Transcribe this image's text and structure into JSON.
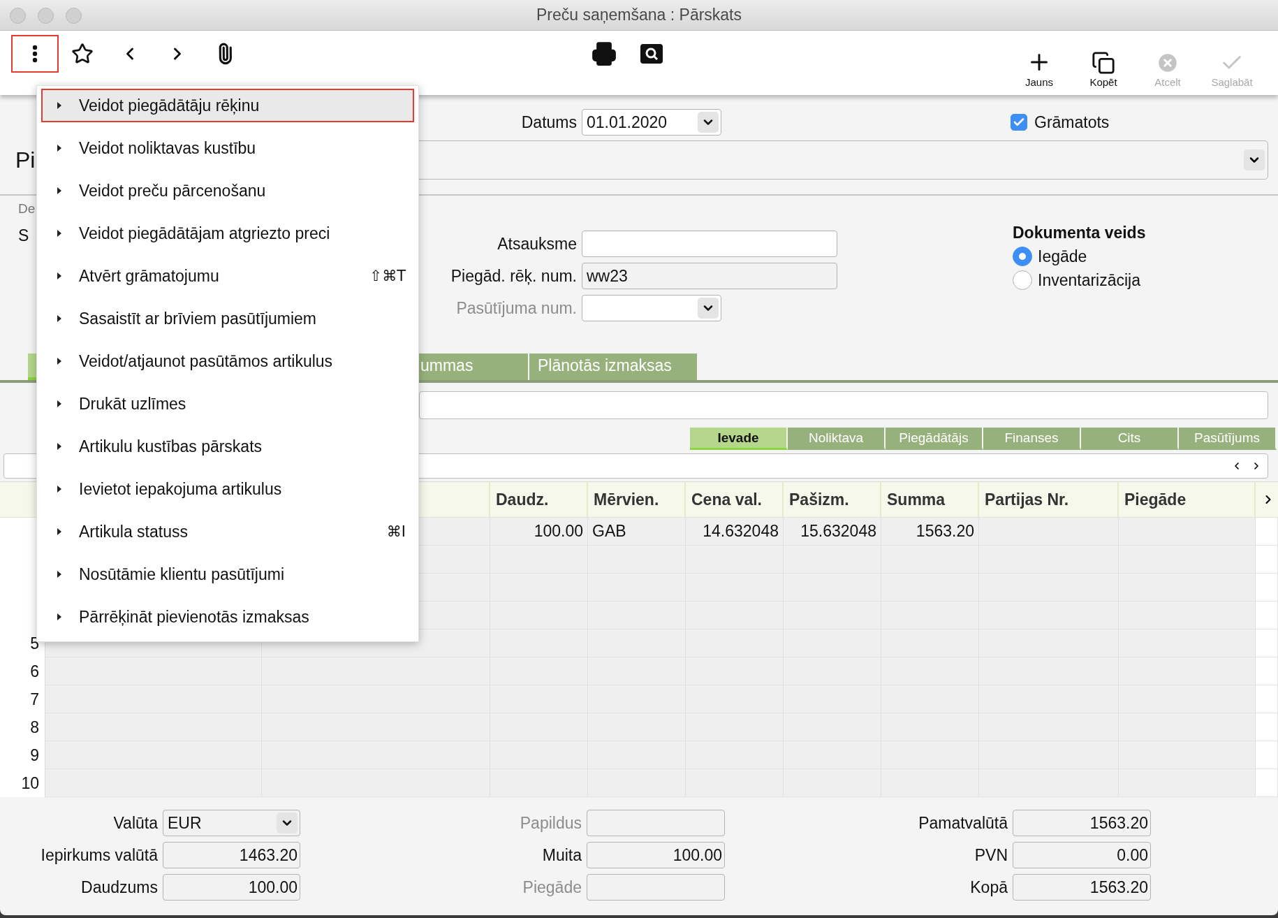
{
  "window": {
    "title": "Preču saņemšana : Pārskats"
  },
  "toolbar": {
    "menu_button": {
      "highlighted": true
    },
    "actions": [
      {
        "kind": "new",
        "label": "Jauns",
        "disabled": false
      },
      {
        "kind": "copy",
        "label": "Kopēt",
        "disabled": false
      },
      {
        "kind": "cancel",
        "label": "Atcelt",
        "disabled": true
      },
      {
        "kind": "save",
        "label": "Saglabāt",
        "disabled": true
      }
    ]
  },
  "header": {
    "date_label": "Datums",
    "date": "01.01.2020",
    "posted": {
      "label": "Grāmatots",
      "checked": true
    },
    "title": "Pi"
  },
  "details": {
    "note": "De",
    "label": "S",
    "fields": [
      {
        "label": "Atsauksme",
        "kind": "text",
        "readonly": false,
        "disabled": false
      },
      {
        "label": "Piegād. rēķ. num.",
        "kind": "text",
        "value": "ww23",
        "readonly": true,
        "disabled": false
      },
      {
        "label": "Pasūtījuma num.",
        "kind": "select",
        "readonly": false,
        "disabled": true
      }
    ]
  },
  "document_type": {
    "title": "Dokumenta veids",
    "options": [
      {
        "label": "Iegāde",
        "selected": true
      },
      {
        "label": "Inventarizācija",
        "selected": false
      }
    ]
  },
  "tabs": [
    {
      "selected": true
    },
    {
      "label": "ummas",
      "selected": false
    },
    {
      "label": "Plānotās izmaksas",
      "selected": false
    }
  ],
  "subtabs": [
    {
      "label": "Ievade",
      "selected": true
    },
    {
      "label": "Noliktava",
      "selected": false
    },
    {
      "label": "Piegādātājs",
      "selected": false
    },
    {
      "label": "Finanses",
      "selected": false
    },
    {
      "label": "Cits",
      "selected": false
    },
    {
      "label": "Pasūtījums",
      "selected": false
    }
  ],
  "table": {
    "columns": [
      {
        "label": "Daudz.",
        "kind": "number"
      },
      {
        "label": "Mērvien.",
        "kind": "text"
      },
      {
        "label": "Cena val.",
        "kind": "number"
      },
      {
        "label": "Pašizm.",
        "kind": "number"
      },
      {
        "label": "Summa",
        "kind": "number"
      },
      {
        "label": "Partijas Nr.",
        "kind": "text"
      },
      {
        "label": "Piegāde",
        "kind": "text"
      }
    ],
    "rows": [
      {
        "cells": [
          "100.00",
          "GAB",
          "14.632048",
          "15.632048",
          "1563.20"
        ]
      },
      {},
      {},
      {},
      {
        "number": "5"
      },
      {
        "number": "6"
      },
      {
        "number": "7"
      },
      {
        "number": "8"
      },
      {
        "number": "9"
      },
      {
        "number": "10"
      }
    ]
  },
  "totals": [
    [
      {
        "label": "Valūta",
        "kind": "select",
        "value": "EUR",
        "disabled": false
      },
      {
        "label": "Iepirkums valūtā",
        "kind": "number",
        "value": "1463.20",
        "disabled": false
      },
      {
        "label": "Daudzums",
        "kind": "number",
        "value": "100.00",
        "disabled": false
      }
    ],
    [
      {
        "label": "Papildus",
        "kind": "number",
        "disabled": true
      },
      {
        "label": "Muita",
        "kind": "number",
        "value": "100.00",
        "disabled": false
      },
      {
        "label": "Piegāde",
        "kind": "number",
        "disabled": true
      }
    ],
    [
      {
        "label": "Pamatvalūtā",
        "kind": "number",
        "value": "1563.20",
        "disabled": false
      },
      {
        "label": "PVN",
        "kind": "number",
        "value": "0.00",
        "disabled": false
      },
      {
        "label": "Kopā",
        "kind": "number",
        "value": "1563.20",
        "disabled": false
      }
    ]
  ],
  "menu": {
    "items": [
      {
        "label": "Veidot piegādātāju rēķinu",
        "selected": true,
        "highlighted": true
      },
      {
        "label": "Veidot noliktavas kustību",
        "selected": false,
        "highlighted": false
      },
      {
        "label": "Veidot preču pārcenošanu",
        "selected": false,
        "highlighted": false
      },
      {
        "label": "Veidot piegādātājam atgriezto preci",
        "selected": false,
        "highlighted": false
      },
      {
        "label": "Atvērt grāmatojumu",
        "shortcut": "⇧⌘T",
        "selected": false,
        "highlighted": false
      },
      {
        "label": "Sasaistīt ar brīviem pasūtījumiem",
        "selected": false,
        "highlighted": false
      },
      {
        "label": "Veidot/atjaunot pasūtāmos artikulus",
        "selected": false,
        "highlighted": false
      },
      {
        "label": "Drukāt uzlīmes",
        "selected": false,
        "highlighted": false
      },
      {
        "label": "Artikulu kustības pārskats",
        "selected": false,
        "highlighted": false
      },
      {
        "label": "Ievietot iepakojuma artikulus",
        "selected": false,
        "highlighted": false
      },
      {
        "label": "Artikula statuss",
        "shortcut": "⌘I",
        "selected": false,
        "highlighted": false
      },
      {
        "label": "Nosūtāmie klientu pasūtījumi",
        "selected": false,
        "highlighted": false
      },
      {
        "label": "Pārrēķināt pievienotās izmaksas",
        "selected": false,
        "highlighted": false
      }
    ]
  }
}
